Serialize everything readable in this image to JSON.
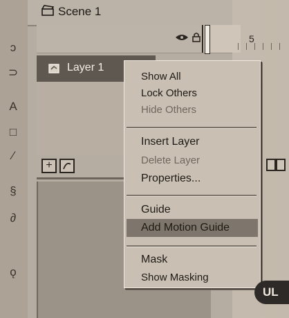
{
  "window": {
    "scene_label": "Scene 1",
    "layer_name": "Layer 1",
    "ruler_number": "5"
  },
  "context_menu": {
    "items": [
      {
        "label": "Show All",
        "enabled": true
      },
      {
        "label": "Lock Others",
        "enabled": true
      },
      {
        "label": "Hide Others",
        "enabled": false
      },
      {
        "label": "Insert Layer",
        "enabled": true
      },
      {
        "label": "Delete Layer",
        "enabled": false
      },
      {
        "label": "Properties...",
        "enabled": true
      },
      {
        "label": "Guide",
        "enabled": true
      },
      {
        "label": "Add Motion Guide",
        "enabled": true,
        "highlighted": true
      },
      {
        "label": "Mask",
        "enabled": true
      },
      {
        "label": "Show Masking",
        "enabled": true
      }
    ]
  },
  "badge": {
    "label": "UL"
  },
  "colors": {
    "menu_bg": "#c9c0b3",
    "highlight": "#7e766c",
    "layer_selected": "#5f5850"
  }
}
